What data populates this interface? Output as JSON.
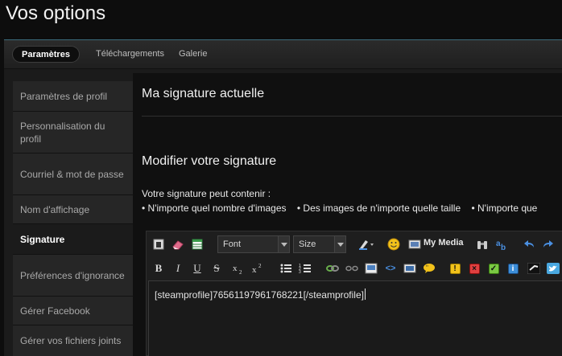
{
  "page": {
    "title": "Vos options"
  },
  "tabs": [
    {
      "label": "Paramètres",
      "active": true
    },
    {
      "label": "Téléchargements",
      "active": false
    },
    {
      "label": "Galerie",
      "active": false
    }
  ],
  "sidebar": {
    "items": [
      {
        "label": "Paramètres de profil",
        "active": false
      },
      {
        "label": "Personnalisation du profil",
        "active": false
      },
      {
        "label": "Courriel & mot de passe",
        "active": false
      },
      {
        "label": "Nom d'affichage",
        "active": false
      },
      {
        "label": "Signature",
        "active": true
      },
      {
        "label": "Préférences d'ignorance",
        "active": false
      },
      {
        "label": "Gérer Facebook",
        "active": false
      },
      {
        "label": "Gérer vos fichiers joints",
        "active": false
      }
    ]
  },
  "content": {
    "current_heading": "Ma signature actuelle",
    "edit_heading": "Modifier votre signature",
    "may_contain": "Votre signature peut contenir :",
    "bullets": [
      "• N'importe quel nombre d'images",
      "• Des images de n'importe quelle taille",
      "• N'importe que"
    ]
  },
  "editor": {
    "font_select": "Font",
    "size_select": "Size",
    "my_media_label": "My Media",
    "value": "[steamprofile]76561197961768221[/steamprofile]"
  },
  "colors": {
    "accent": "#3a6a7a",
    "background": "#0d0d0d"
  }
}
